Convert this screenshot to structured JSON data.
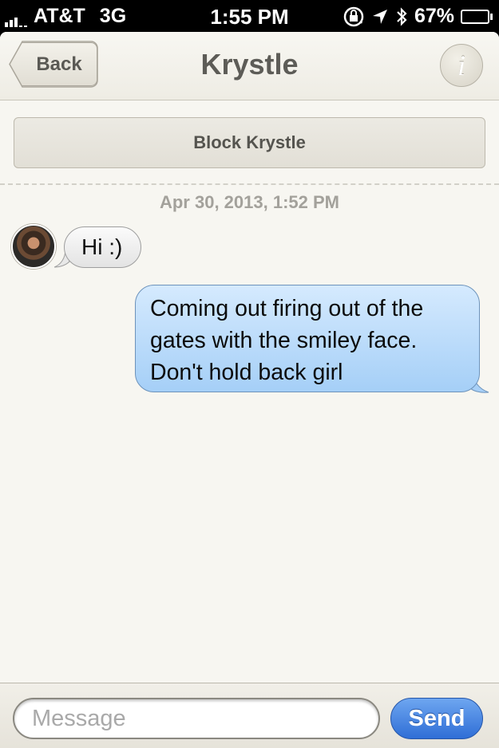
{
  "status_bar": {
    "carrier": "AT&T",
    "network": "3G",
    "time": "1:55 PM",
    "battery_percent": "67%",
    "battery_level": 0.67,
    "signal_bars": 3
  },
  "navbar": {
    "back_label": "Back",
    "title": "Krystle",
    "info_glyph": "i"
  },
  "block_button_label": "Block Krystle",
  "conversation": {
    "timestamp": "Apr 30, 2013, 1:52 PM",
    "messages": [
      {
        "direction": "incoming",
        "text": "Hi :)"
      },
      {
        "direction": "outgoing",
        "lines": [
          "Coming out firing out of the",
          "gates with the smiley face.",
          "Don't hold back girl"
        ]
      }
    ]
  },
  "composer": {
    "placeholder": "Message",
    "value": "",
    "send_label": "Send"
  },
  "colors": {
    "incoming_bubble": "#f0f0f0",
    "outgoing_bubble": "#b9dcfb",
    "send_button": "#3a78df",
    "background": "#f7f6f1"
  }
}
